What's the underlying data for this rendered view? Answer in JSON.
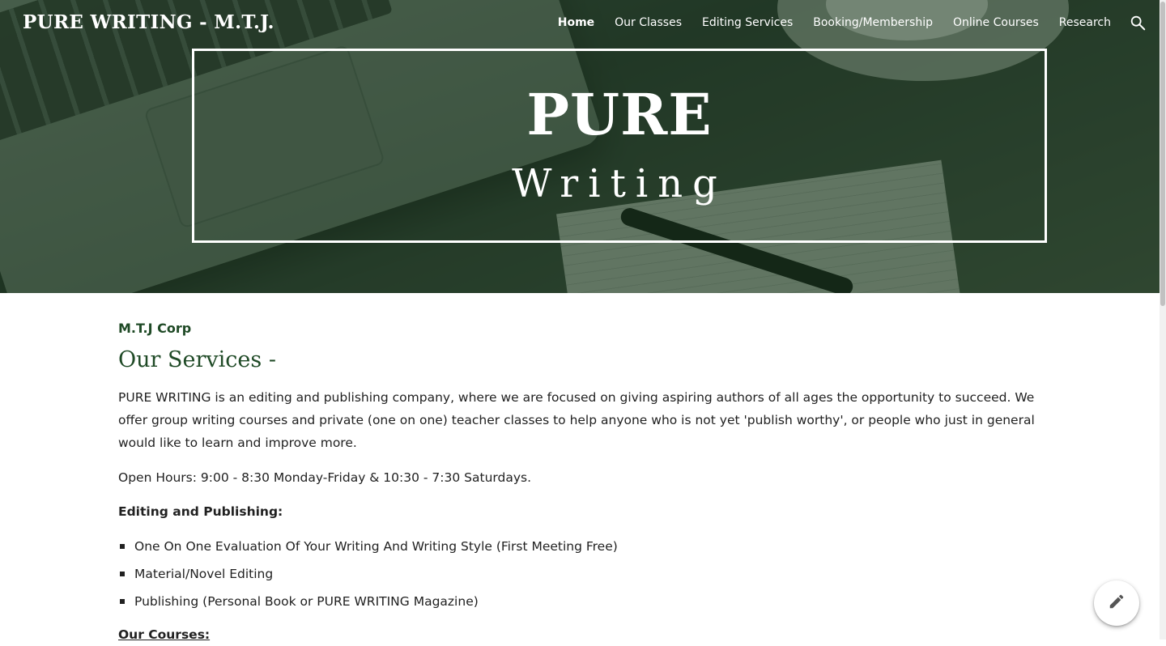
{
  "header": {
    "site_title": "PURE WRITING - M.T.J.",
    "nav": [
      {
        "label": "Home",
        "active": true
      },
      {
        "label": "Our Classes",
        "active": false
      },
      {
        "label": "Editing Services",
        "active": false
      },
      {
        "label": "Booking/Membership",
        "active": false
      },
      {
        "label": "Online Courses",
        "active": false
      },
      {
        "label": "Research",
        "active": false
      }
    ],
    "search_icon": "search-icon"
  },
  "hero": {
    "title": "PURE",
    "subtitle": "Writing"
  },
  "main": {
    "company": "M.T.J Corp",
    "services_heading": "Our Services -",
    "intro": "PURE WRITING is an editing and publishing company, where we are focused on giving aspiring authors of all ages the opportunity to succeed. We offer group writing courses and private (one on one) teacher classes to help anyone who is not yet 'publish worthy', or people who just in general would like to learn and improve more.",
    "hours": "Open Hours: 9:00 - 8:30 Monday-Friday & 10:30 - 7:30 Saturdays.",
    "editing_heading": "Editing and Publishing:",
    "editing_items": [
      "One On One Evaluation Of Your Writing And Writing Style (First Meeting Free)",
      "Material/Novel Editing",
      "Publishing (Personal Book or PURE WRITING Magazine)"
    ],
    "courses_heading": "Our Courses:"
  },
  "fab": {
    "icon": "pencil-icon"
  },
  "colors": {
    "accent_green": "#1f4a26",
    "hero_overlay": "#19371e"
  }
}
